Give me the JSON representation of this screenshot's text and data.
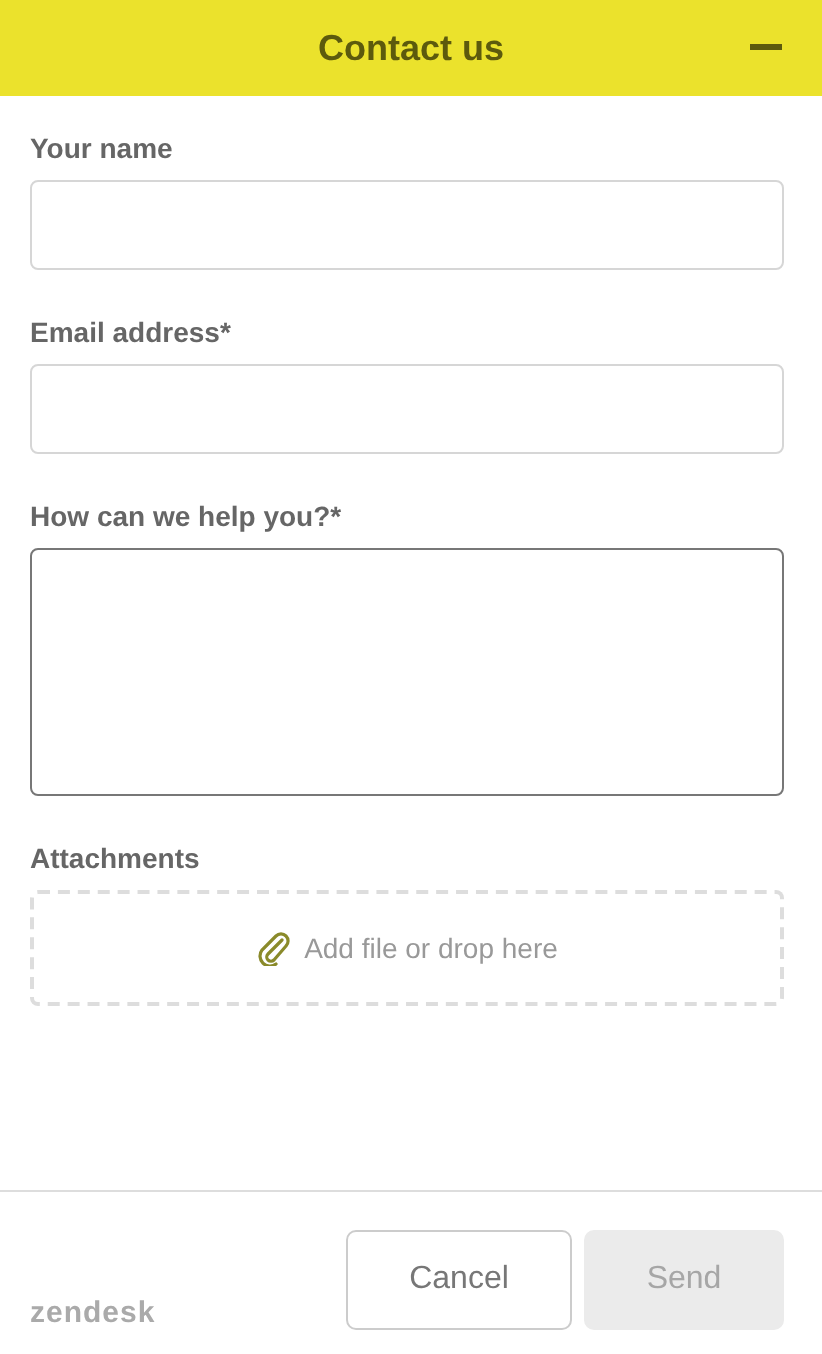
{
  "header": {
    "title": "Contact us"
  },
  "fields": [
    {
      "label": "Your name",
      "kind": "text"
    },
    {
      "label": "Email address*",
      "kind": "text"
    },
    {
      "label": "How can we help you?*",
      "kind": "textarea"
    }
  ],
  "attachments": {
    "label": "Attachments",
    "hint": "Add file or drop here"
  },
  "footer": {
    "brand": "zendesk",
    "buttons": [
      {
        "label": "Cancel",
        "disabled": false
      },
      {
        "label": "Send",
        "disabled": true
      }
    ]
  }
}
